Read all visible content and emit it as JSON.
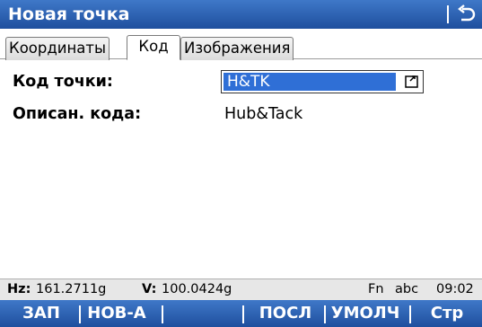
{
  "window": {
    "title": "Новая точка",
    "back_icon": "return-arrow-icon"
  },
  "tabs": [
    {
      "label": "Координаты",
      "active": false
    },
    {
      "label": "Код",
      "active": true
    },
    {
      "label": "Изображения",
      "active": false
    }
  ],
  "form": {
    "point_code": {
      "label": "Код точки:",
      "value": "H&TK",
      "button_icon": "list-picker-icon"
    },
    "code_description": {
      "label": "Описан. кода:",
      "value": "Hub&Tack"
    }
  },
  "status": {
    "hz_label": "Hz:",
    "hz_value": "161.2711g",
    "v_label": "V:",
    "v_value": "100.0424g",
    "fn": "Fn",
    "input_mode": "abc",
    "time": "09:02"
  },
  "softkeys": {
    "zap": "ЗАП",
    "new": "НОВ-А",
    "last": "ПОСЛ",
    "default": "УМОЛЧ",
    "page": "Стр"
  },
  "colors": {
    "bar": "#2a5fb0",
    "selection": "#2f6fd6",
    "status_bg": "#e7e7e7"
  }
}
